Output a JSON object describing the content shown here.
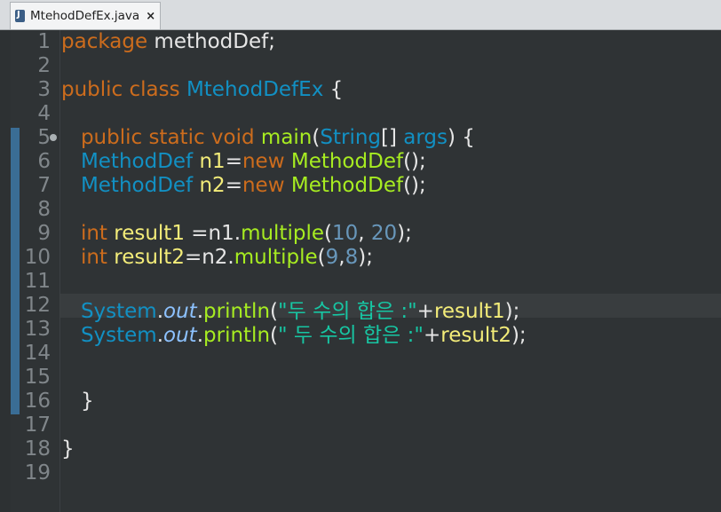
{
  "tab": {
    "title": "MtehodDefEx.java",
    "close": "×",
    "icon": "java-file-icon"
  },
  "editor": {
    "line_numbers": [
      "1",
      "2",
      "3",
      "4",
      "5",
      "6",
      "7",
      "8",
      "9",
      "10",
      "11",
      "12",
      "13",
      "14",
      "15",
      "16",
      "17",
      "18",
      "19"
    ],
    "current_line": 12,
    "code": {
      "l1": {
        "kw": "package",
        "rest": "methodDef;"
      },
      "l3": {
        "kw1": "public",
        "kw2": "class",
        "cls": "MtehodDefEx",
        "rest": "{"
      },
      "l5": {
        "kw1": "public",
        "kw2": "static",
        "kw3": "void",
        "fn": "main",
        "p1": "(",
        "cls": "String",
        "p2": "[]",
        "arg": "args",
        "p3": ") {"
      },
      "l6": {
        "cls": "MethodDef",
        "var": "n1",
        "eq": "=",
        "kw": "new",
        "fn": "MethodDef",
        "p": "();"
      },
      "l7": {
        "cls": "MethodDef",
        "var": "n2",
        "eq": "=",
        "kw": "new",
        "fn": "MethodDef",
        "p": "();"
      },
      "l9": {
        "kw": "int",
        "var": "result1",
        "mid": "=n1.",
        "fn": "multiple",
        "p1": "(",
        "n1": "10",
        "c": ",",
        "n2": "20",
        "p2": ");"
      },
      "l10": {
        "kw": "int",
        "var": "result2",
        "mid": "=n2.",
        "fn": "multiple",
        "p1": "(",
        "n1": "9",
        "c": ",",
        "n2": "8",
        "p2": ");"
      },
      "l12": {
        "cls": "System",
        "dot": ".",
        "out": "out",
        "dot2": ".",
        "fn": "println",
        "p1": "(",
        "str": "\"두 수의 합은 :\"",
        "plus": "+",
        "var": "result1",
        "p2": ");"
      },
      "l13": {
        "cls": "System",
        "dot": ".",
        "out": "out",
        "dot2": ".",
        "fn": "println",
        "p1": "(",
        "str": "\" 두 수의 합은 :\"",
        "plus": "+",
        "var": "result2",
        "p2": ");"
      },
      "l16": {
        "brace": "}"
      },
      "l18": {
        "brace": "}"
      }
    }
  }
}
